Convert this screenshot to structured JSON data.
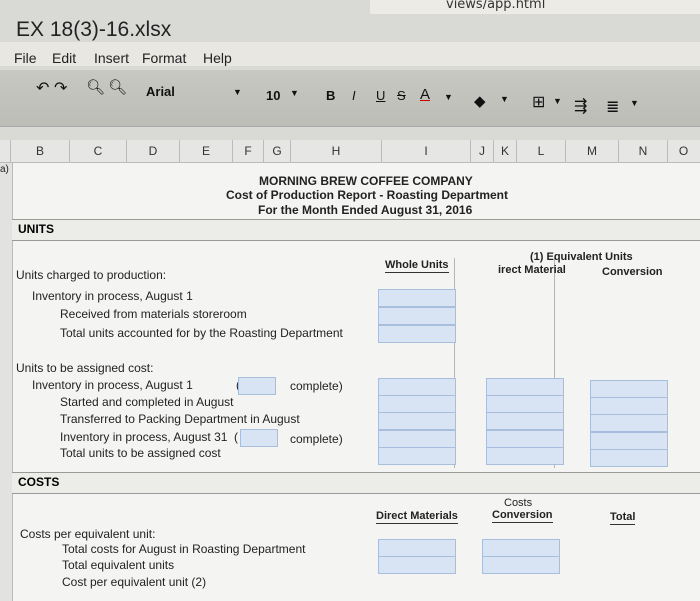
{
  "browser": {
    "url_fragment": "views/app.html"
  },
  "window": {
    "title": "EX 18(3)-16.xlsx"
  },
  "menu": [
    "File",
    "Edit",
    "Insert",
    "Format",
    "Help"
  ],
  "toolbar": {
    "font": "Arial",
    "size": "10",
    "bold": "B",
    "italic": "I",
    "underline": "U",
    "strike": "S",
    "color": "A"
  },
  "columns": [
    "B",
    "C",
    "D",
    "E",
    "F",
    "G",
    "H",
    "I",
    "J",
    "K",
    "L",
    "M",
    "N",
    "O"
  ],
  "report": {
    "company": "MORNING BREW COFFEE COMPANY",
    "title": "Cost of Production Report - Roasting Department",
    "period": "For the Month Ended August 31, 2016"
  },
  "units": {
    "section": "UNITS",
    "whole_units": "Whole Units",
    "eq_title": "(1) Equivalent Units",
    "eq_dm": "irect Material",
    "eq_conv": "Conversion",
    "charged": "Units charged to production:",
    "inv_aug1": "Inventory in process, August 1",
    "received": "Received from materials storeroom",
    "total_acc": "Total units accounted for by the Roasting Department",
    "assigned": "Units to be assigned cost:",
    "inv_aug1b": "Inventory in process, August 1",
    "paren_open": "(",
    "complete": "complete)",
    "started": "Started and completed in August",
    "transferred": "Transferred to Packing Department in August",
    "inv_aug31": "Inventory in process, August 31",
    "paren_open2": "(",
    "complete2": "complete)",
    "total_assigned": "Total units to be assigned cost"
  },
  "costs": {
    "section": "COSTS",
    "dm": "Direct Materials",
    "costs_label": "Costs",
    "conv": "Conversion",
    "total": "Total",
    "per_eq": "Costs per equivalent unit:",
    "total_costs": "Total costs for August in Roasting Department",
    "total_eq": "Total equivalent units",
    "cost_per": "Cost per equivalent unit (2)"
  },
  "row_marker": "a)"
}
